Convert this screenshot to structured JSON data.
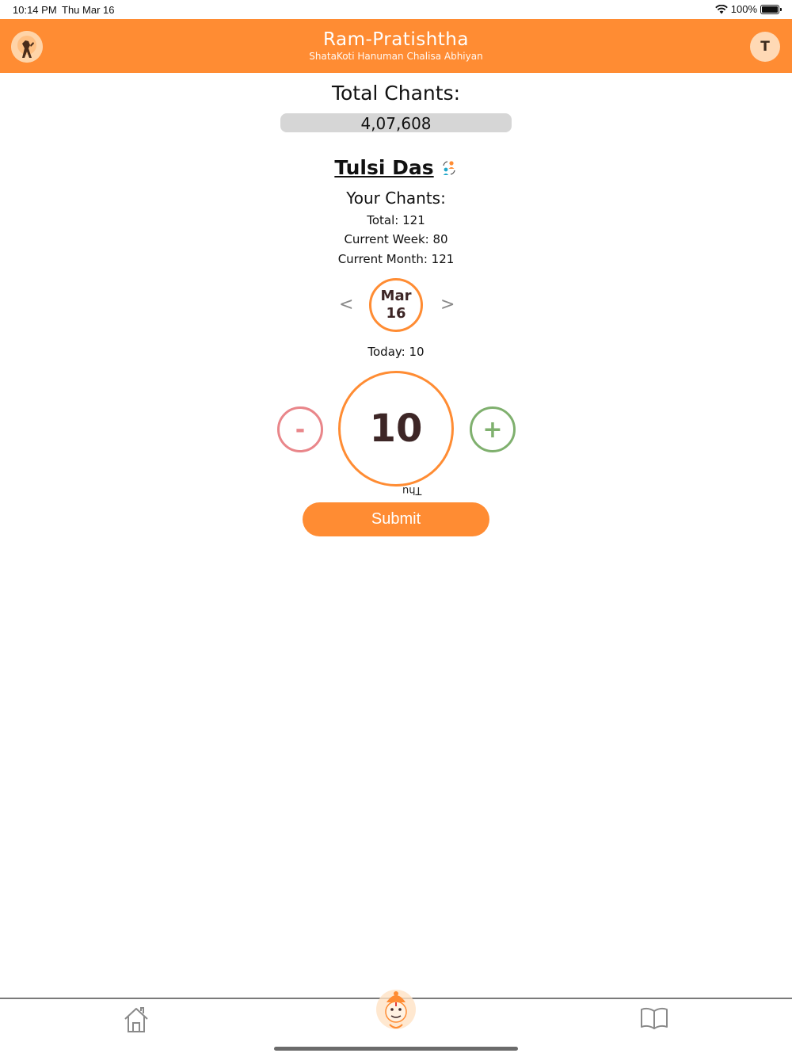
{
  "status_bar": {
    "time": "10:14 PM",
    "date": "Thu Mar 16",
    "battery": "100%"
  },
  "header": {
    "title": "Ram-Pratishtha",
    "subtitle": "ShataKoti Hanuman Chalisa Abhiyan",
    "avatar_initial": "T",
    "background_color": "#ff8c33"
  },
  "totals": {
    "heading": "Total Chants:",
    "value": "4,07,608"
  },
  "user": {
    "name": "Tulsi Das",
    "your_chants_label": "Your Chants:",
    "total": "Total: 121",
    "current_week": "Current Week: 80",
    "current_month": "Current Month: 121"
  },
  "date_picker": {
    "prev_label": "<",
    "next_label": ">",
    "month": "Mar",
    "day": "16"
  },
  "today": {
    "label": "Today: 10"
  },
  "counter": {
    "minus_label": "-",
    "plus_label": "+",
    "value": "10",
    "day_label": "Thu"
  },
  "submit_label": "Submit",
  "tabbar": {
    "items": [
      "home",
      "hanuman",
      "book"
    ],
    "icons": [
      "home-icon",
      "hanuman-icon",
      "book-icon"
    ]
  },
  "colors": {
    "accent": "#ff8c33",
    "minus": "#e9868a",
    "plus": "#7fb06e",
    "text_dark": "#3d2626"
  }
}
